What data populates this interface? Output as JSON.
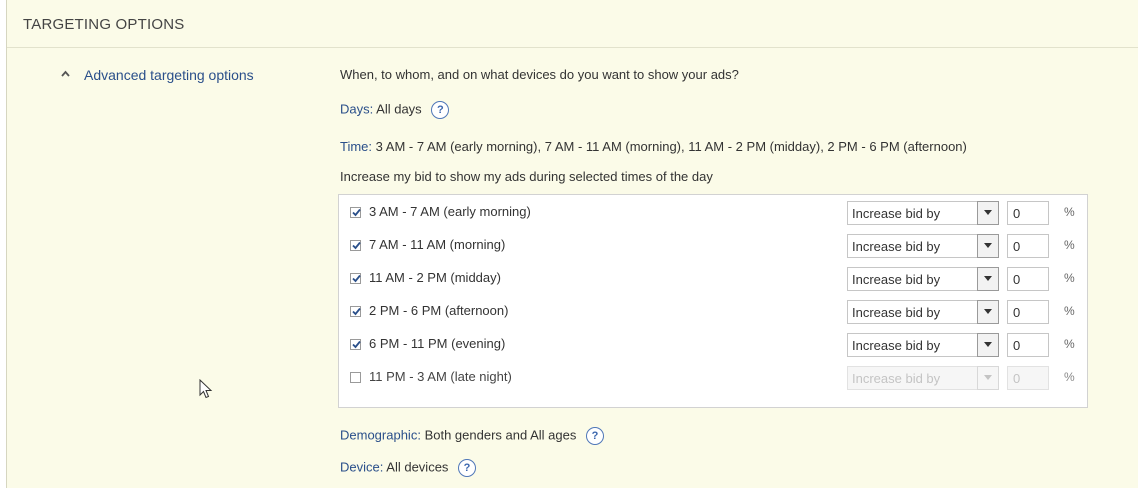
{
  "section": {
    "title": "TARGETING OPTIONS"
  },
  "advanced": {
    "label": "Advanced targeting options",
    "icon": "chevron-up-icon"
  },
  "question": "When, to whom, and on what devices do you want to show your ads?",
  "days": {
    "key": "Days",
    "value": "All days"
  },
  "time": {
    "key": "Time",
    "value": "3 AM - 7 AM (early morning), 7 AM - 11 AM (morning), 11 AM - 2 PM (midday), 2 PM - 6 PM (afternoon)"
  },
  "increase_prompt": "Increase my bid to show my ads during selected times of the day",
  "help_label": "?",
  "schedule": [
    {
      "label": "3 AM - 7 AM (early morning)",
      "checked": true,
      "select": "Increase bid by",
      "value": "0",
      "unit": "%"
    },
    {
      "label": "7 AM - 11 AM (morning)",
      "checked": true,
      "select": "Increase bid by",
      "value": "0",
      "unit": "%"
    },
    {
      "label": "11 AM - 2 PM (midday)",
      "checked": true,
      "select": "Increase bid by",
      "value": "0",
      "unit": "%"
    },
    {
      "label": "2 PM - 6 PM (afternoon)",
      "checked": true,
      "select": "Increase bid by",
      "value": "0",
      "unit": "%"
    },
    {
      "label": "6 PM - 11 PM (evening)",
      "checked": true,
      "select": "Increase bid by",
      "value": "0",
      "unit": "%"
    },
    {
      "label": "11 PM - 3 AM (late night)",
      "checked": false,
      "select": "Increase bid by",
      "value": "0",
      "unit": "%"
    }
  ],
  "demographic": {
    "key": "Demographic",
    "value": "Both genders and All ages"
  },
  "device": {
    "key": "Device",
    "value": "All devices"
  },
  "colors": {
    "panel": "#fbfbe8",
    "link": "#2a4f8a",
    "help": "#3b66ad"
  }
}
